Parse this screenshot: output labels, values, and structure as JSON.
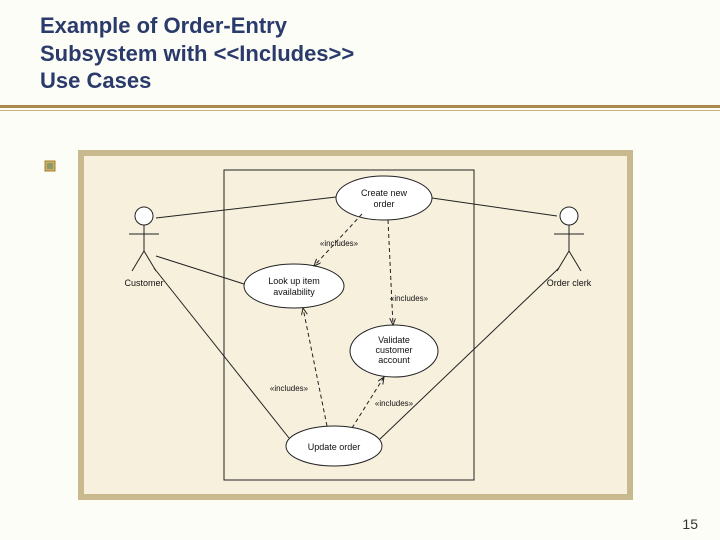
{
  "slide": {
    "title_line1": "Example of Order-Entry",
    "title_line2": "Subsystem with <<Includes>>",
    "title_line3": "Use Cases",
    "page_number": "15"
  },
  "diagram": {
    "actors": [
      {
        "id": "customer",
        "label": "Customer"
      },
      {
        "id": "order_clerk",
        "label": "Order clerk"
      }
    ],
    "use_cases": [
      {
        "id": "create_new_order",
        "label_line1": "Create new",
        "label_line2": "order"
      },
      {
        "id": "look_up_item",
        "label_line1": "Look up item",
        "label_line2": "availability"
      },
      {
        "id": "validate_customer",
        "label_line1": "Validate",
        "label_line2": "customer",
        "label_line3": "account"
      },
      {
        "id": "update_order",
        "label_line1": "Update order"
      }
    ],
    "include_label": "«includes»"
  }
}
